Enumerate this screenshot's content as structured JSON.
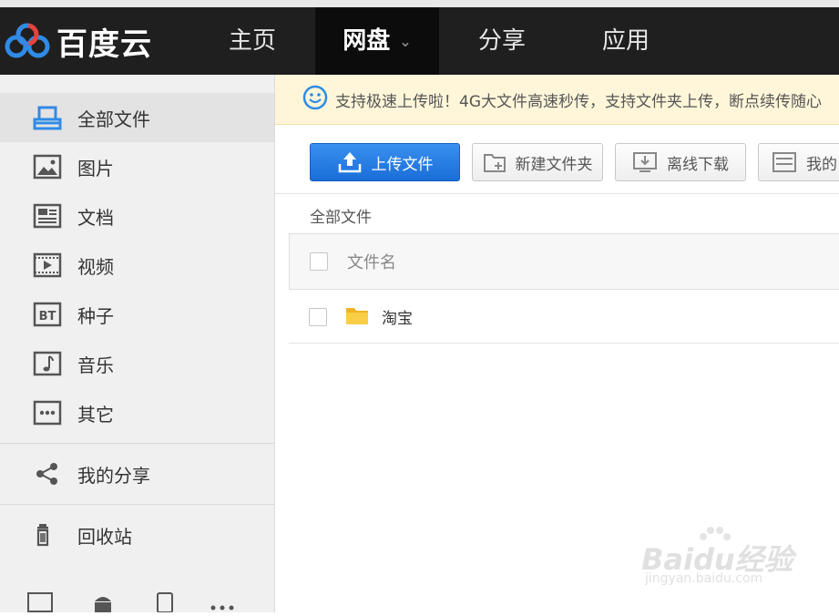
{
  "app": {
    "logo_text": "百度云"
  },
  "nav": [
    {
      "label": "主页"
    },
    {
      "label": "网盘"
    },
    {
      "label": "分享"
    },
    {
      "label": "应用"
    }
  ],
  "sidebar": {
    "items": [
      {
        "label": "全部文件",
        "icon": "all-files-icon"
      },
      {
        "label": "图片",
        "icon": "picture-icon"
      },
      {
        "label": "文档",
        "icon": "document-icon"
      },
      {
        "label": "视频",
        "icon": "video-icon"
      },
      {
        "label": "种子",
        "icon": "bt-icon"
      },
      {
        "label": "音乐",
        "icon": "music-icon"
      },
      {
        "label": "其它",
        "icon": "other-icon"
      }
    ],
    "share": {
      "label": "我的分享",
      "icon": "share-icon"
    },
    "trash": {
      "label": "回收站",
      "icon": "trash-icon"
    }
  },
  "notice": {
    "text": "支持极速上传啦！4G大文件高速秒传，支持文件夹上传，断点续传随心"
  },
  "toolbar": {
    "upload": "上传文件",
    "new_folder": "新建文件夹",
    "offline": "离线下载",
    "mine": "我的"
  },
  "breadcrumb": "全部文件",
  "table": {
    "header": "文件名",
    "rows": [
      {
        "name": "淘宝",
        "type": "folder"
      }
    ]
  },
  "watermark": {
    "text": "Baidu经验",
    "sub": "jingyan.baidu.com"
  },
  "colors": {
    "topbar": "#1f1f1f",
    "primary": "#1a6ed8",
    "accent_icon": "#2f8be6",
    "notice_bg": "#fff6d9"
  }
}
